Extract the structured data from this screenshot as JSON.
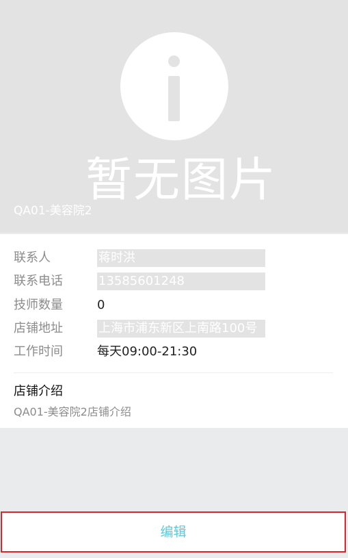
{
  "banner": {
    "placeholder_icon": "info-icon",
    "placeholder_text": "暂无图片",
    "store_name": "QA01-美容院2"
  },
  "details": {
    "rows": [
      {
        "label": "联系人",
        "value": "蒋时洪"
      },
      {
        "label": "联系电话",
        "value": "13585601248"
      },
      {
        "label": "技师数量",
        "value": "0"
      },
      {
        "label": "店铺地址",
        "value": "上海市浦东新区上南路100号"
      },
      {
        "label": "工作时间",
        "value": "每天09:00-21:30"
      }
    ]
  },
  "intro": {
    "title": "店铺介绍",
    "text": "QA01-美容院2店铺介绍"
  },
  "actions": {
    "edit_label": "编辑"
  },
  "colors": {
    "banner_background": "#e3e3e3",
    "page_background": "#e9ebed",
    "edit_text": "#5bc8dd",
    "edit_border": "#d9262c"
  }
}
